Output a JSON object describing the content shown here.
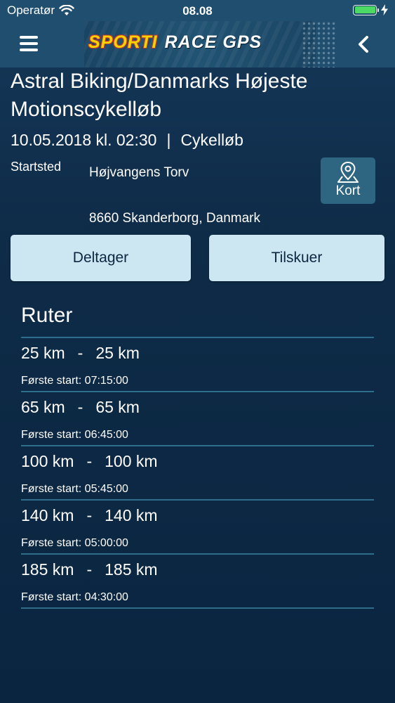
{
  "status_bar": {
    "carrier": "Operatør",
    "time": "08.08",
    "battery_level": 1.0,
    "icons": [
      "wifi-icon",
      "battery-icon",
      "charging-bolt-icon"
    ]
  },
  "header": {
    "brand_primary": "SPORTI",
    "brand_secondary": "RACE GPS",
    "menu_icon": "hamburger-menu-icon",
    "back_icon": "chevron-left-icon"
  },
  "event": {
    "title": "Astral Biking/Danmarks Højeste Motionscykelløb",
    "datetime": "10.05.2018 kl. 02:30",
    "separator": "|",
    "type": "Cykelløb",
    "start_label": "Startsted",
    "address_line1": "Højvangens Torv",
    "address_line2": "8660 Skanderborg, Danmark",
    "map_button_label": "Kort",
    "map_icon": "map-pin-icon"
  },
  "actions": {
    "participant_label": "Deltager",
    "spectator_label": "Tilskuer"
  },
  "routes": {
    "title": "Ruter",
    "items": [
      {
        "from": "25 km",
        "to": "25 km",
        "first_start": "Første start: 07:15:00"
      },
      {
        "from": "65 km",
        "to": "65 km",
        "first_start": "Første start: 06:45:00"
      },
      {
        "from": "100 km",
        "to": "100 km",
        "first_start": "Første start: 05:45:00"
      },
      {
        "from": "140 km",
        "to": "140 km",
        "first_start": "Første start: 05:00:00"
      },
      {
        "from": "185 km",
        "to": "185 km",
        "first_start": "Første start: 04:30:00"
      }
    ],
    "dash": "-"
  },
  "colors": {
    "background": "#0d2a45",
    "header": "#1f4e6e",
    "button": "#cde7f2",
    "divider": "#2f6e8a",
    "brand_yellow": "#f5d400"
  }
}
